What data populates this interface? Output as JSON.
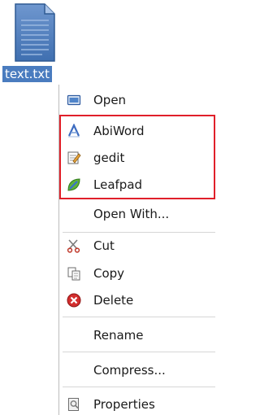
{
  "desktop": {
    "file_name": "text.txt",
    "file_icon": "text-file-icon"
  },
  "menu": {
    "items": [
      {
        "label": "Open",
        "icon": "open-folder-icon"
      },
      {
        "label": "AbiWord",
        "icon": "abiword-icon"
      },
      {
        "label": "gedit",
        "icon": "gedit-icon"
      },
      {
        "label": "Leafpad",
        "icon": "leafpad-icon"
      },
      {
        "label": "Open With...",
        "icon": ""
      },
      {
        "label": "Cut",
        "icon": "scissors-icon"
      },
      {
        "label": "Copy",
        "icon": "copy-icon"
      },
      {
        "label": "Delete",
        "icon": "delete-icon"
      },
      {
        "label": "Rename",
        "icon": ""
      },
      {
        "label": "Compress...",
        "icon": ""
      },
      {
        "label": "Properties",
        "icon": "properties-icon"
      }
    ]
  },
  "colors": {
    "selection_label_bg": "#4a7cbf",
    "highlight_border": "#e0202a"
  }
}
